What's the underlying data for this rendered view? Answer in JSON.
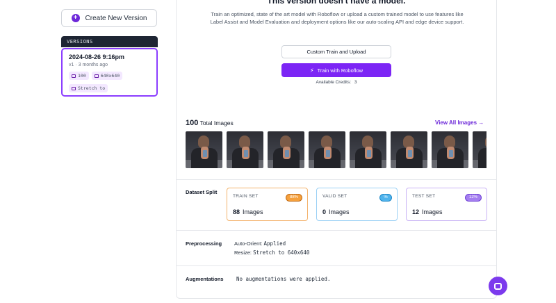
{
  "sidebar": {
    "create_label": "Create New Version",
    "versions_heading": "VERSIONS",
    "version": {
      "date": "2024-08-26 9:16pm",
      "subtitle": "v1 · 3 months ago",
      "image_count": "100",
      "size": "640x640",
      "resize": "Stretch to"
    }
  },
  "main": {
    "title": "This version doesn't have a model.",
    "description": "Train an optimized, state of the art model with Roboflow or upload a custom trained model to use features like Label Assist and Model Evaluation and deployment options like our auto-scaling API and edge device support.",
    "custom_button": "Custom Train and Upload",
    "train_button": "Train with Roboflow",
    "credits_label": "Available Credits:",
    "credits_value": "3",
    "total_count": "100",
    "total_label": "Total Images",
    "view_all": "View All Images →",
    "thumbnail_count": 8
  },
  "dataset_split": {
    "label": "Dataset Split",
    "sets": [
      {
        "name": "TRAIN SET",
        "percent": "88%",
        "count": "88",
        "unit": "Images",
        "color": "#f5a03c"
      },
      {
        "name": "VALID SET",
        "percent": "%",
        "count": "0",
        "unit": "Images",
        "color": "#4fb3ec"
      },
      {
        "name": "TEST SET",
        "percent": "12%",
        "count": "12",
        "unit": "Images",
        "color": "#a47ef0"
      }
    ]
  },
  "preprocessing": {
    "label": "Preprocessing",
    "auto_orient_key": "Auto-Orient:",
    "auto_orient_value": "Applied",
    "resize_key": "Resize:",
    "resize_value": "Stretch to 640x640"
  },
  "augmentations": {
    "label": "Augmentations",
    "value": "No augmentations were applied."
  }
}
